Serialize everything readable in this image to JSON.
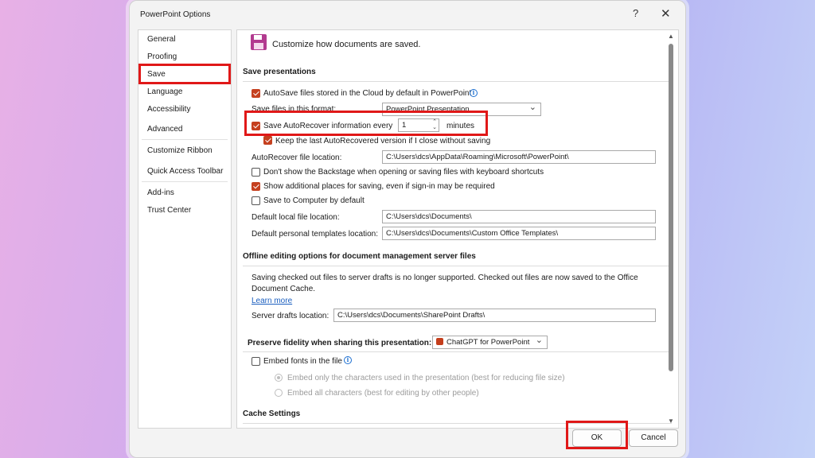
{
  "window": {
    "title": "PowerPoint Options",
    "help_glyph": "?",
    "close_glyph": "✕"
  },
  "nav": {
    "items": [
      "General",
      "Proofing",
      "Save",
      "Language",
      "Accessibility",
      "Advanced",
      "Customize Ribbon",
      "Quick Access Toolbar",
      "Add-ins",
      "Trust Center"
    ],
    "selected": "Save"
  },
  "header": {
    "text": "Customize how documents are saved."
  },
  "save_presentations": {
    "title": "Save presentations",
    "autosave_label": "AutoSave files stored in the Cloud by default in PowerPoint",
    "autosave_checked": true,
    "format_label": "Save files in this format:",
    "format_value": "PowerPoint Presentation",
    "autorecover_label": "Save AutoRecover information every",
    "autorecover_checked": true,
    "autorecover_minutes": "1",
    "minutes_label": "minutes",
    "keep_last_label": "Keep the last AutoRecovered version if I close without saving",
    "keep_last_checked": true,
    "autorecover_location_label": "AutoRecover file location:",
    "autorecover_location_value": "C:\\Users\\dcs\\AppData\\Roaming\\Microsoft\\PowerPoint\\",
    "backstage_label": "Don't show the Backstage when opening or saving files with keyboard shortcuts",
    "backstage_checked": false,
    "additional_places_label": "Show additional places for saving, even if sign-in may be required",
    "additional_places_checked": true,
    "save_to_computer_label": "Save to Computer by default",
    "save_to_computer_checked": false,
    "default_local_label": "Default local file location:",
    "default_local_value": "C:\\Users\\dcs\\Documents\\",
    "templates_label": "Default personal templates location:",
    "templates_value": "C:\\Users\\dcs\\Documents\\Custom Office Templates\\"
  },
  "offline": {
    "title": "Offline editing options for document management server files",
    "text_line1": "Saving checked out files to server drafts is no longer supported. Checked out files are now saved to the Office",
    "text_line2": "Document Cache.",
    "learn_more": "Learn more",
    "drafts_label": "Server drafts location:",
    "drafts_value": "C:\\Users\\dcs\\Documents\\SharePoint Drafts\\"
  },
  "fidelity": {
    "title": "Preserve fidelity when sharing this presentation:",
    "presentation_value": "ChatGPT for PowerPoint",
    "embed_label": "Embed fonts in the file",
    "embed_checked": false,
    "embed_only_label": "Embed only the characters used in the presentation (best for reducing file size)",
    "embed_all_label": "Embed all characters (best for editing by other people)"
  },
  "cache": {
    "title": "Cache Settings"
  },
  "footer": {
    "ok": "OK",
    "cancel": "Cancel"
  },
  "colors": {
    "highlight": "#e01818",
    "checkbox": "#c5401f",
    "link": "#1a5ebf"
  },
  "icons": {
    "header": "save-floppy-icon",
    "info": "info-icon",
    "chevron": "chevron-down-icon",
    "powerpoint": "powerpoint-icon"
  }
}
